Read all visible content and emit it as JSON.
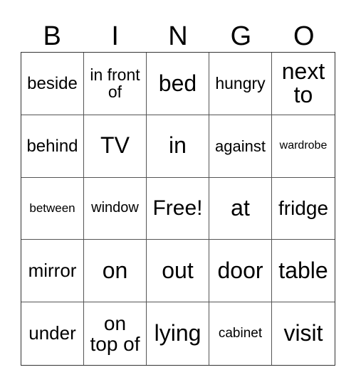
{
  "header": [
    "B",
    "I",
    "N",
    "G",
    "O"
  ],
  "cells": [
    {
      "text": "beside",
      "size": 24
    },
    {
      "text": "in front\nof",
      "size": 23
    },
    {
      "text": "bed",
      "size": 32
    },
    {
      "text": "hungry",
      "size": 23
    },
    {
      "text": "next\nto",
      "size": 32
    },
    {
      "text": "behind",
      "size": 24
    },
    {
      "text": "TV",
      "size": 32
    },
    {
      "text": "in",
      "size": 32
    },
    {
      "text": "against",
      "size": 22
    },
    {
      "text": "wardrobe",
      "size": 16
    },
    {
      "text": "between",
      "size": 17
    },
    {
      "text": "window",
      "size": 20
    },
    {
      "text": "Free!",
      "size": 30
    },
    {
      "text": "at",
      "size": 32
    },
    {
      "text": "fridge",
      "size": 28
    },
    {
      "text": "mirror",
      "size": 26
    },
    {
      "text": "on",
      "size": 32
    },
    {
      "text": "out",
      "size": 32
    },
    {
      "text": "door",
      "size": 32
    },
    {
      "text": "table",
      "size": 32
    },
    {
      "text": "under",
      "size": 26
    },
    {
      "text": "on\ntop of",
      "size": 28
    },
    {
      "text": "lying",
      "size": 32
    },
    {
      "text": "cabinet",
      "size": 19
    },
    {
      "text": "visit",
      "size": 32
    }
  ]
}
